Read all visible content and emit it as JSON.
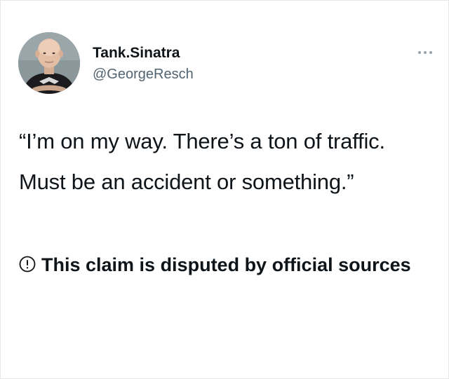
{
  "tweet": {
    "author": {
      "display_name": "Tank.Sinatra",
      "handle": "@GeorgeResch",
      "avatar_icon": "avatar"
    },
    "more_icon": "more-horizontal-icon",
    "text": "“I’m on my way. There’s a ton of traffic. Must be an accident or something.”",
    "notice": {
      "icon": "info-icon",
      "text": "This claim is disputed by official sources"
    }
  },
  "colors": {
    "text": "#0f1419",
    "secondary_text": "#536471",
    "background": "#ffffff"
  }
}
